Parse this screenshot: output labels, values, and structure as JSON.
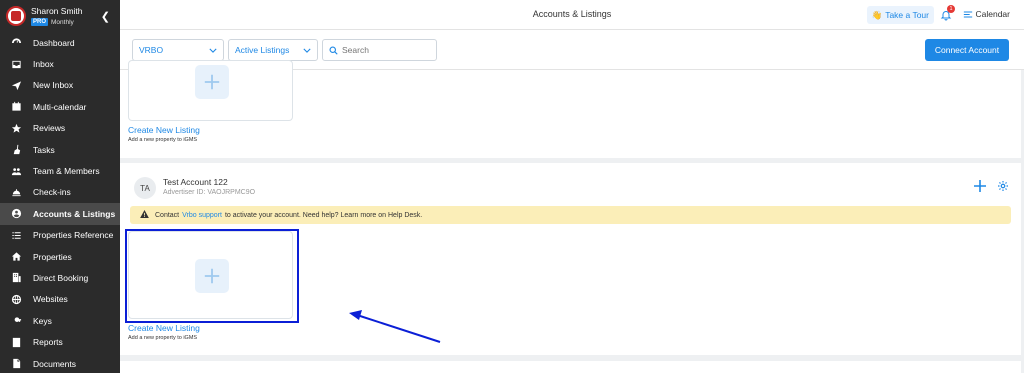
{
  "user": {
    "name": "Sharon Smith",
    "badge": "PRO",
    "plan": "Monthly"
  },
  "nav": {
    "items": [
      {
        "label": "Dashboard",
        "icon": "dashboard-icon",
        "active": false
      },
      {
        "label": "Inbox",
        "icon": "inbox-icon",
        "active": false
      },
      {
        "label": "New Inbox",
        "icon": "send-icon",
        "active": false
      },
      {
        "label": "Multi-calendar",
        "icon": "calendar-grid-icon",
        "active": false
      },
      {
        "label": "Reviews",
        "icon": "star-icon",
        "active": false
      },
      {
        "label": "Tasks",
        "icon": "broom-icon",
        "active": false
      },
      {
        "label": "Team & Members",
        "icon": "team-icon",
        "active": false
      },
      {
        "label": "Check-ins",
        "icon": "bell-service-icon",
        "active": false
      },
      {
        "label": "Accounts & Listings",
        "icon": "account-circle-icon",
        "active": true
      },
      {
        "label": "Properties Reference",
        "icon": "list-icon",
        "active": false
      },
      {
        "label": "Properties",
        "icon": "home-icon",
        "active": false
      },
      {
        "label": "Direct Booking",
        "icon": "building-icon",
        "active": false
      },
      {
        "label": "Websites",
        "icon": "globe-icon",
        "active": false
      },
      {
        "label": "Keys",
        "icon": "key-icon",
        "active": false
      },
      {
        "label": "Reports",
        "icon": "report-icon",
        "active": false
      },
      {
        "label": "Documents",
        "icon": "document-icon",
        "active": false
      }
    ]
  },
  "header": {
    "title": "Accounts & Listings",
    "tour_label": "Take a Tour",
    "notification_count": "1",
    "calendar_label": "Calendar"
  },
  "filters": {
    "source_value": "VRBO",
    "status_value": "Active Listings",
    "search_placeholder": "Search",
    "connect_label": "Connect Account"
  },
  "top_section": {
    "create_label": "Create New Listing",
    "create_sub": "Add a new property to iGMS"
  },
  "account": {
    "initials": "TA",
    "name": "Test Account 122",
    "advertiser_id": "Advertiser ID: VAOJRPMC9O",
    "warning_prefix": "Contact",
    "warning_link": "Vrbo support",
    "warning_suffix": "to activate your account. Need help? Learn more on Help Desk.",
    "create_label": "Create New Listing",
    "create_sub": "Add a new property to iGMS"
  },
  "colors": {
    "accent": "#1e88e5",
    "sidebar": "#2b2b2b",
    "warning_bg": "#fbeeb8",
    "annotation": "#0b1fd6"
  }
}
